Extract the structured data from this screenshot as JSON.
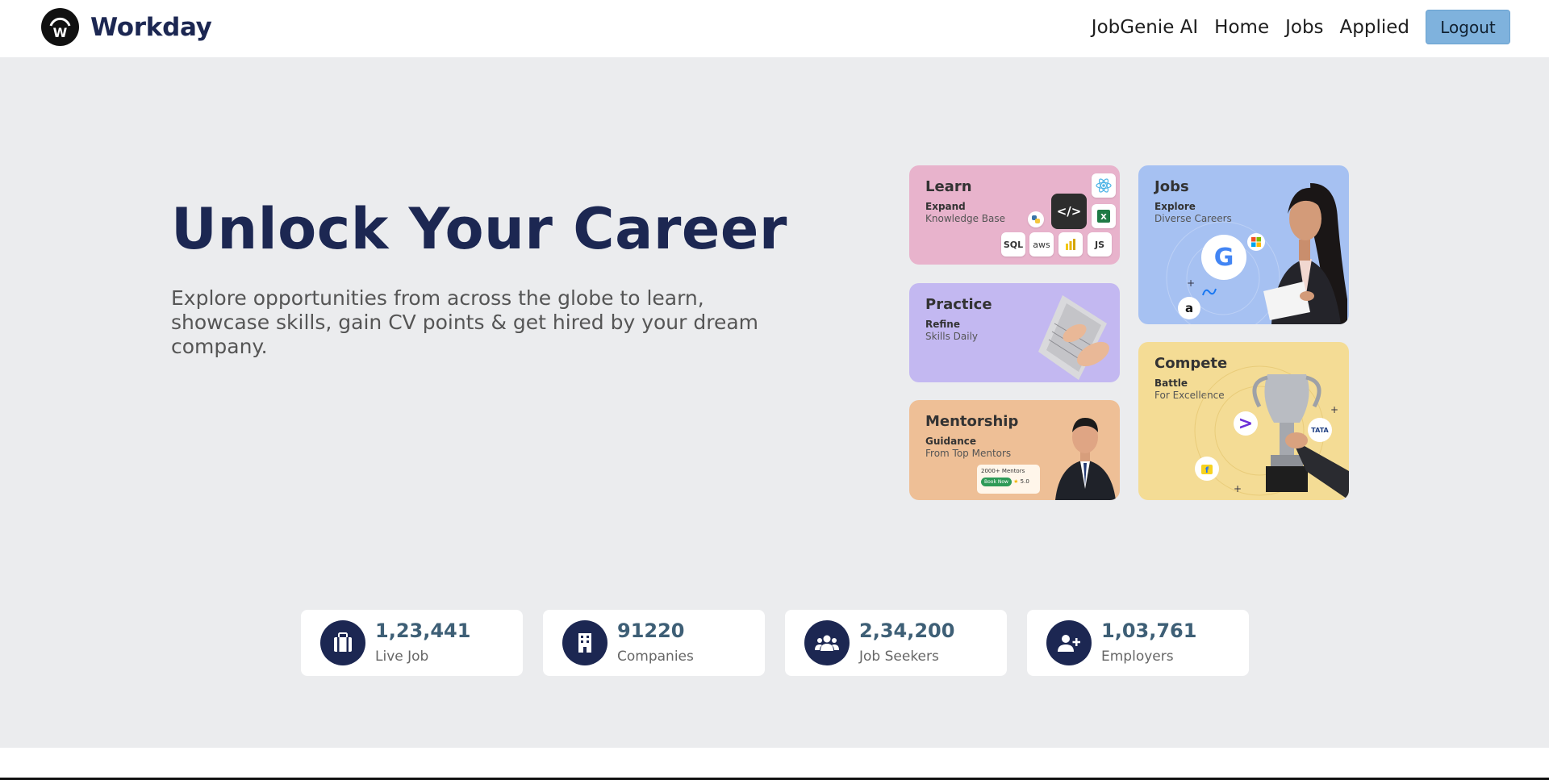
{
  "header": {
    "brand_name": "Workday",
    "logo_letter": "W",
    "nav": [
      "JobGenie AI",
      "Home",
      "Jobs",
      "Applied"
    ],
    "logout_label": "Logout"
  },
  "hero": {
    "title": "Unlock Your Career",
    "subtitle": "Explore opportunities from across the globe to learn, showcase skills, gain CV points & get hired by your dream company."
  },
  "cards": {
    "learn": {
      "title": "Learn",
      "kicker": "Expand",
      "sub": "Knowledge Base",
      "tiles": [
        "SQL",
        "aws",
        "JS",
        "</>"
      ]
    },
    "practice": {
      "title": "Practice",
      "kicker": "Refine",
      "sub": "Skills Daily"
    },
    "mentorship": {
      "title": "Mentorship",
      "kicker": "Guidance",
      "sub": "From Top Mentors",
      "pill_text": "2000+ Mentors",
      "pill_button": "Book Now",
      "pill_rating": "5.0"
    },
    "jobs": {
      "title": "Jobs",
      "kicker": "Explore",
      "sub": "Diverse Careers",
      "logo_g": "G",
      "logo_a": "a"
    },
    "compete": {
      "title": "Compete",
      "kicker": "Battle",
      "sub": "For Excellence",
      "logo_tata": "TATA",
      "logo_arrow": ">"
    }
  },
  "stats": [
    {
      "number": "1,23,441",
      "label": "Live Job",
      "icon": "briefcase-icon"
    },
    {
      "number": "91220",
      "label": "Companies",
      "icon": "building-icon"
    },
    {
      "number": "2,34,200",
      "label": "Job Seekers",
      "icon": "users-icon"
    },
    {
      "number": "1,03,761",
      "label": "Employers",
      "icon": "user-plus-icon"
    }
  ],
  "colors": {
    "brand_navy": "#1c2752",
    "logout_bg": "#7fb2dd",
    "hero_bg": "#ebecee",
    "learn": "#e8b3cc",
    "practice": "#c3b8f1",
    "mentorship": "#eebf96",
    "jobs": "#a6c1f2",
    "compete": "#f4dc95"
  }
}
